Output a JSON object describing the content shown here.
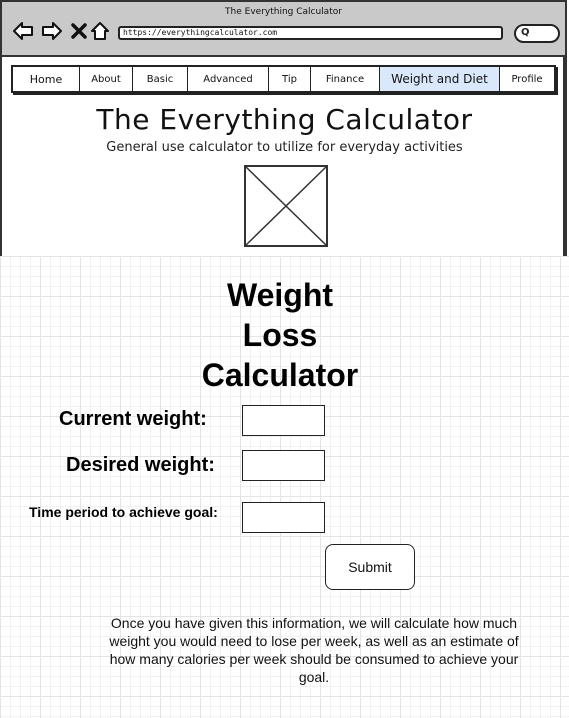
{
  "window": {
    "title": "The Everything Calculator"
  },
  "browser": {
    "url": "https://everythingcalculator.com",
    "search_glyph": "Q",
    "nav_icons": [
      "back-arrow-icon",
      "forward-arrow-icon",
      "close-icon",
      "home-icon"
    ]
  },
  "tabs": [
    {
      "label": "Home"
    },
    {
      "label": "About"
    },
    {
      "label": "Basic"
    },
    {
      "label": "Advanced"
    },
    {
      "label": "Tip"
    },
    {
      "label": "Finance"
    },
    {
      "label": "Weight and Diet",
      "active": true
    },
    {
      "label": "Profile"
    }
  ],
  "site": {
    "title": "The Everything Calculator",
    "subtitle": "General use calculator to utilize for everyday activities"
  },
  "calculator": {
    "title_lines": [
      "Weight",
      "Loss",
      "Calculator"
    ],
    "fields": {
      "current_weight": {
        "label": "Current weight:",
        "value": ""
      },
      "desired_weight": {
        "label": "Desired weight:",
        "value": ""
      },
      "time_period": {
        "label": "Time period to achieve goal:",
        "value": ""
      }
    },
    "submit_label": "Submit",
    "info_text": "Once you have given this information, we will calculate how much weight you would need to lose per week, as well as an estimate of how many calories per week should be consumed to achieve your goal."
  },
  "colors": {
    "active_tab": "#dae8fc",
    "chrome": "#c9c9c9"
  }
}
